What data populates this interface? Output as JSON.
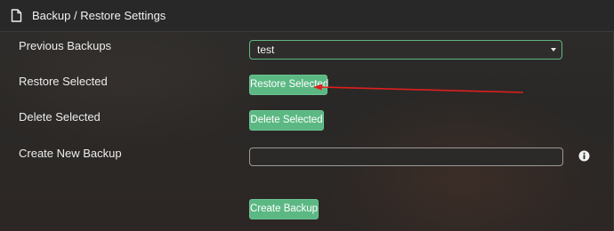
{
  "header": {
    "title": "Backup / Restore Settings",
    "icon": "document-icon"
  },
  "rows": {
    "previous_backups": {
      "label": "Previous Backups",
      "selected_value": "test"
    },
    "restore_selected": {
      "label": "Restore Selected",
      "button_label": "Restore Selected"
    },
    "delete_selected": {
      "label": "Delete Selected",
      "button_label": "Delete Selected"
    },
    "create_new_backup": {
      "label": "Create New Backup",
      "input_value": "",
      "info_icon": "info-circle-icon"
    }
  },
  "create_backup": {
    "button_label": "Create Backup"
  },
  "colors": {
    "accent_green": "#5cb883",
    "annotation_red": "#e01e1e"
  }
}
